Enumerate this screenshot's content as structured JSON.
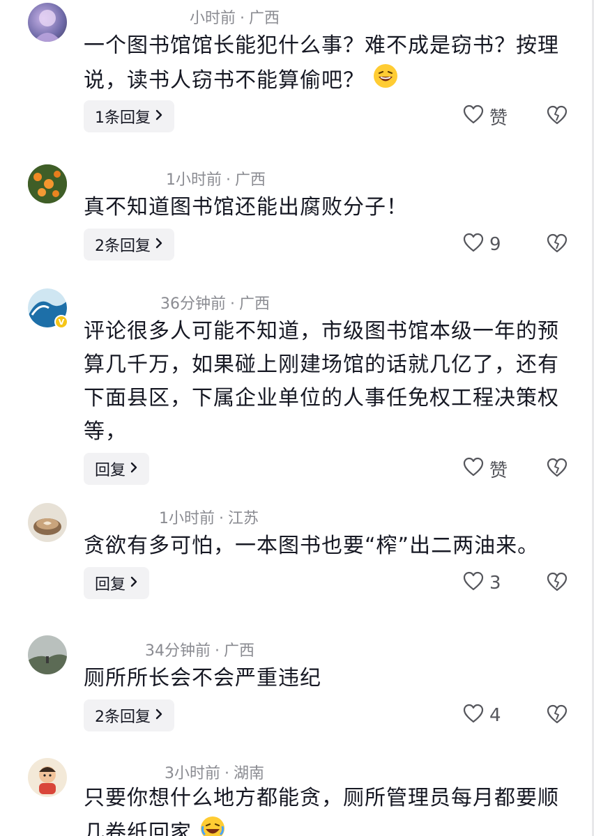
{
  "comments": [
    {
      "time": "小时前",
      "region": "广西",
      "text": "一个图书馆馆长能犯什么事？难不成是窃书？按理说，读书人窃书不能算偷吧？",
      "reply_label": "1条回复",
      "like_label": "赞"
    },
    {
      "time": "1小时前",
      "region": "广西",
      "text": "真不知道图书馆还能出腐败分子！",
      "reply_label": "2条回复",
      "like_label": "9"
    },
    {
      "time": "36分钟前",
      "region": "广西",
      "text": "评论很多人可能不知道，市级图书馆本级一年的预算几千万，如果碰上刚建场馆的话就几亿了，还有下面县区，下属企业单位的人事任免权工程决策权等，",
      "reply_label": "回复",
      "like_label": "赞",
      "verified_badge": "V"
    },
    {
      "time": "1小时前",
      "region": "江苏",
      "text": "贪欲有多可怕，一本图书也要“榨”出二两油来。",
      "reply_label": "回复",
      "like_label": "3"
    },
    {
      "time": "34分钟前",
      "region": "广西",
      "text": "厕所所长会不会严重违纪",
      "reply_label": "2条回复",
      "like_label": "4"
    },
    {
      "time": "3小时前",
      "region": "湖南",
      "text": "只要你想什么地方都能贪，厕所管理员每月都要顺几卷纸回家",
      "reply_label": "",
      "like_label": ""
    }
  ],
  "separator": "·",
  "icons": {
    "chevron": "chevron-right-icon",
    "like": "heart-outline-icon",
    "dislike": "broken-heart-icon",
    "emoji": "laughing-emoji-icon"
  },
  "colors": {
    "text": "#161823",
    "meta": "#8a8b91",
    "reply_bg": "#f2f2f4",
    "icon": "#55565c"
  }
}
